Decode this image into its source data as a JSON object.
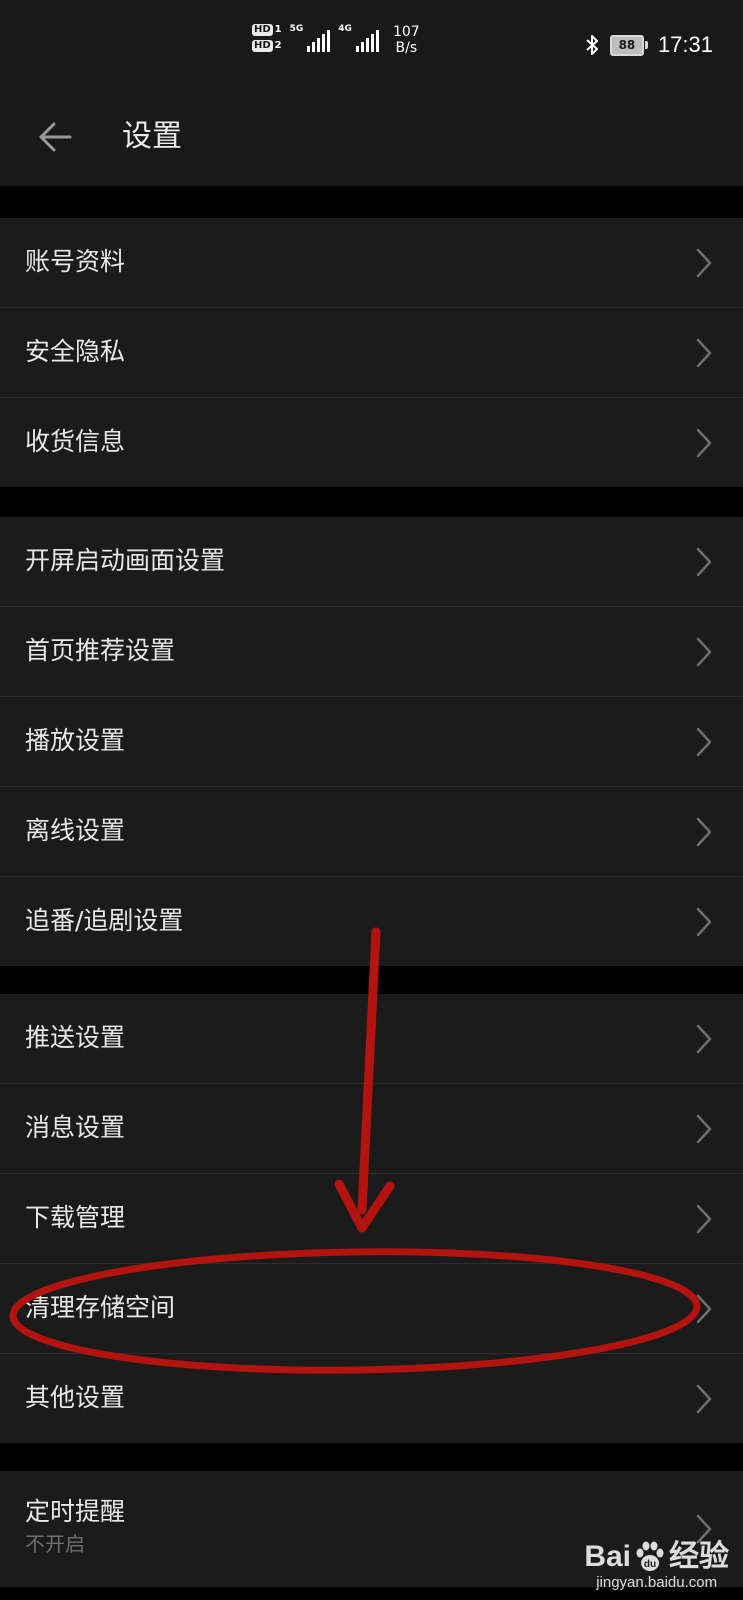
{
  "status_bar": {
    "hd1": "HD",
    "hd1_sub": "1",
    "hd2": "HD",
    "hd2_sub": "2",
    "net1": "5G",
    "net2": "4G",
    "speed_value": "107",
    "speed_unit": "B/s",
    "battery": "88",
    "time": "17:31"
  },
  "header": {
    "title": "设置",
    "back_icon": "arrow-left-icon"
  },
  "groups": [
    {
      "items": [
        {
          "label": "账号资料"
        },
        {
          "label": "安全隐私"
        },
        {
          "label": "收货信息"
        }
      ]
    },
    {
      "items": [
        {
          "label": "开屏启动画面设置"
        },
        {
          "label": "首页推荐设置"
        },
        {
          "label": "播放设置"
        },
        {
          "label": "离线设置"
        },
        {
          "label": "追番/追剧设置"
        }
      ]
    },
    {
      "items": [
        {
          "label": "推送设置"
        },
        {
          "label": "消息设置"
        },
        {
          "label": "下载管理"
        },
        {
          "label": "清理存储空间"
        },
        {
          "label": "其他设置"
        }
      ]
    },
    {
      "items": [
        {
          "label": "定时提醒",
          "sub": "不开启"
        }
      ]
    }
  ],
  "watermark": {
    "brand_left": "Bai",
    "brand_right": "经验",
    "url": "jingyan.baidu.com"
  },
  "colors": {
    "background": "#000000",
    "panel": "#1b1b1b",
    "annotation_red": "#b3140f"
  }
}
